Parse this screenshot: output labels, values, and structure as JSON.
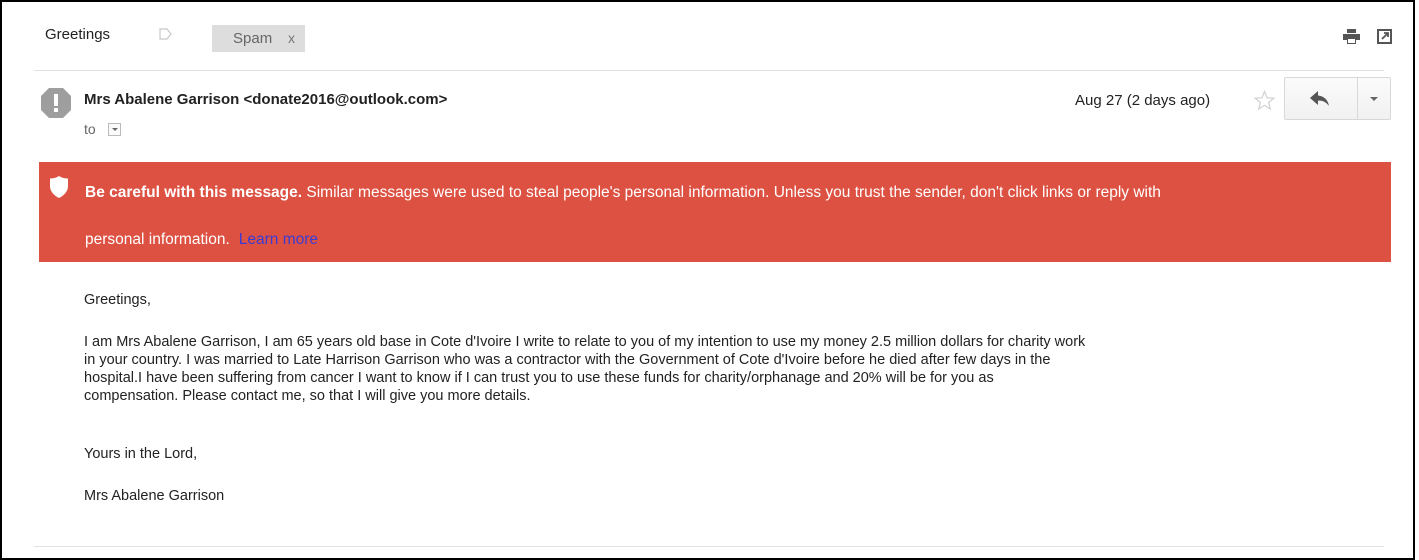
{
  "header": {
    "subject": "Greetings",
    "label_chip": "Spam",
    "label_chip_close": "x"
  },
  "message": {
    "sender": "Mrs Abalene Garrison <donate2016@outlook.com>",
    "to_label": "to",
    "date": "Aug 27 (2 days ago)"
  },
  "warning": {
    "bold_text": "Be careful with this message.",
    "line1_rest": "Similar messages were used to steal people's personal information. Unless you trust the sender, don't click links or reply with",
    "line2": "personal information.",
    "learn_more": "Learn more",
    "background_color": "#dd5142",
    "link_color": "#3b3bd6"
  },
  "body": {
    "greeting": "Greetings,",
    "paragraph_lines": [
      "I am Mrs Abalene Garrison, I am 65 years old base in Cote d'Ivoire I write to relate to you of my intention to use my money 2.5 million dollars for charity work",
      "in your country. I was married to Late Harrison Garrison who was a contractor with the Government of Cote d'Ivoire before he died after few days in the",
      "hospital.I have been suffering from cancer I want to know if I can trust you to use these funds for charity/orphanage and 20% will be for you as",
      "compensation. Please contact me, so that I will give you more details."
    ],
    "signoff": "Yours in the Lord,",
    "signature": "Mrs Abalene Garrison"
  },
  "icons": {
    "label": "label-tag-icon",
    "print": "print-icon",
    "popout": "popout-icon",
    "avatar": "warning-avatar-icon",
    "star": "star-icon",
    "reply": "reply-icon",
    "more": "chevron-down-icon",
    "shield": "shield-icon"
  }
}
